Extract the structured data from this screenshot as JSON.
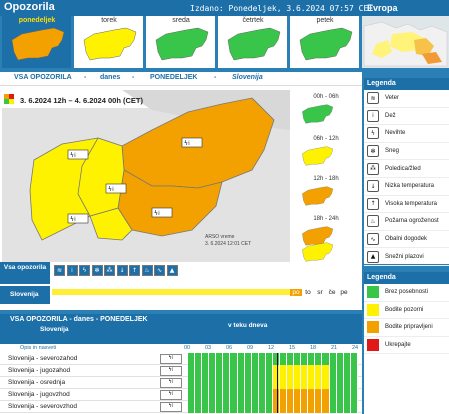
{
  "header": {
    "title": "Opozorila",
    "issued": "Izdano: Ponedeljek, 3.6.2024 07:57 CET",
    "europe": "Evropa"
  },
  "days": [
    {
      "name": "ponedeljek",
      "selected": true,
      "level": "orange"
    },
    {
      "name": "torek",
      "selected": false,
      "level": "yellow"
    },
    {
      "name": "sreda",
      "selected": false,
      "level": "green"
    },
    {
      "name": "četrtek",
      "selected": false,
      "level": "green"
    },
    {
      "name": "petek",
      "selected": false,
      "level": "green"
    }
  ],
  "section": {
    "title": "VSA OPOZORILA",
    "sep1": "-",
    "when": "danes",
    "sep2": "-",
    "day": "PONEDELJEK",
    "sep3": "-",
    "region": "Slovenija"
  },
  "range": "3. 6.2024  12h  –  4. 6.2024  00h     (CET)",
  "arso": {
    "line1": "ARSO vreme",
    "line2": "3. 6.2024  12:01 CET"
  },
  "slots": [
    {
      "label": "00h - 06h",
      "level": "green"
    },
    {
      "label": "06h - 12h",
      "level": "yellow"
    },
    {
      "label": "12h - 18h",
      "level": "orange"
    },
    {
      "label": "18h - 24h",
      "level": "orange"
    },
    {
      "label": "",
      "level": "yellow"
    }
  ],
  "legend": {
    "title": "Legenda",
    "items": [
      {
        "icon": "wind-icon",
        "glyph": "≋",
        "label": "Veter"
      },
      {
        "icon": "rain-icon",
        "glyph": "⁞",
        "label": "Dež"
      },
      {
        "icon": "thunderstorm-icon",
        "glyph": "ϟ",
        "label": "Nevihte"
      },
      {
        "icon": "snow-icon",
        "glyph": "✻",
        "label": "Sneg"
      },
      {
        "icon": "freezing-rain-icon",
        "glyph": "⁂",
        "label": "Poledica/žled"
      },
      {
        "icon": "low-temperature-icon",
        "glyph": "↓",
        "label": "Nizka temperatura"
      },
      {
        "icon": "high-temperature-icon",
        "glyph": "↑",
        "label": "Visoka temperatura"
      },
      {
        "icon": "fire-danger-icon",
        "glyph": "♨",
        "label": "Požarna ogroženost"
      },
      {
        "icon": "coastal-event-icon",
        "glyph": "∿",
        "label": "Obalni dogodek"
      },
      {
        "icon": "avalanche-icon",
        "glyph": "▲",
        "label": "Snežni plazovi"
      }
    ]
  },
  "levels": {
    "title": "Legenda",
    "items": [
      {
        "label": "Brez posebnosti",
        "color": "#39c44a"
      },
      {
        "label": "Bodite pozorni",
        "color": "#fff200"
      },
      {
        "label": "Bodite pripravljeni",
        "color": "#f3a100"
      },
      {
        "label": "Ukrepajte",
        "color": "#e01818"
      }
    ]
  },
  "op_row": {
    "label": "Vsa opozorila"
  },
  "slo_row": {
    "label": "Slovenija",
    "days": [
      "po",
      "to",
      "sr",
      "če",
      "pe"
    ]
  },
  "table": {
    "title": "VSA OPOZORILA - danes - PONEDELJEK",
    "sub": "Slovenija",
    "teku": "v teku dneva",
    "opis": "Opis in nasveti",
    "hours": [
      "00",
      "03",
      "06",
      "09",
      "12",
      "15",
      "18",
      "21",
      "24"
    ],
    "rows": [
      {
        "name": "Slovenija - severozahod",
        "cells": [
          "g",
          "g",
          "g",
          "g",
          "g",
          "g",
          "g",
          "g",
          "g",
          "g",
          "g",
          "g",
          "g",
          "g",
          "g",
          "g",
          "g",
          "g",
          "g",
          "g",
          "g",
          "g",
          "g",
          "g"
        ]
      },
      {
        "name": "Slovenija - jugozahod",
        "cells": [
          "g",
          "g",
          "g",
          "g",
          "g",
          "g",
          "g",
          "g",
          "g",
          "g",
          "g",
          "g",
          "y",
          "y",
          "y",
          "y",
          "y",
          "y",
          "y",
          "y",
          "g",
          "g",
          "g",
          "g"
        ]
      },
      {
        "name": "Slovenija - osrednja",
        "cells": [
          "g",
          "g",
          "g",
          "g",
          "g",
          "g",
          "g",
          "g",
          "g",
          "g",
          "g",
          "g",
          "y",
          "y",
          "y",
          "y",
          "y",
          "y",
          "y",
          "y",
          "g",
          "g",
          "g",
          "g"
        ]
      },
      {
        "name": "Slovenija - jugovzhod",
        "cells": [
          "g",
          "g",
          "g",
          "g",
          "g",
          "g",
          "g",
          "g",
          "g",
          "g",
          "g",
          "g",
          "o",
          "o",
          "o",
          "o",
          "o",
          "o",
          "o",
          "o",
          "g",
          "g",
          "g",
          "g"
        ]
      },
      {
        "name": "Slovenija - severovzhod",
        "cells": [
          "g",
          "g",
          "g",
          "g",
          "g",
          "g",
          "g",
          "g",
          "g",
          "g",
          "g",
          "g",
          "o",
          "o",
          "o",
          "o",
          "o",
          "o",
          "o",
          "o",
          "g",
          "g",
          "g",
          "g"
        ]
      }
    ]
  },
  "colors": {
    "g": "#39c44a",
    "y": "#fff200",
    "o": "#f3a100",
    "r": "#e01818",
    "brand": "#1d6fa8"
  }
}
